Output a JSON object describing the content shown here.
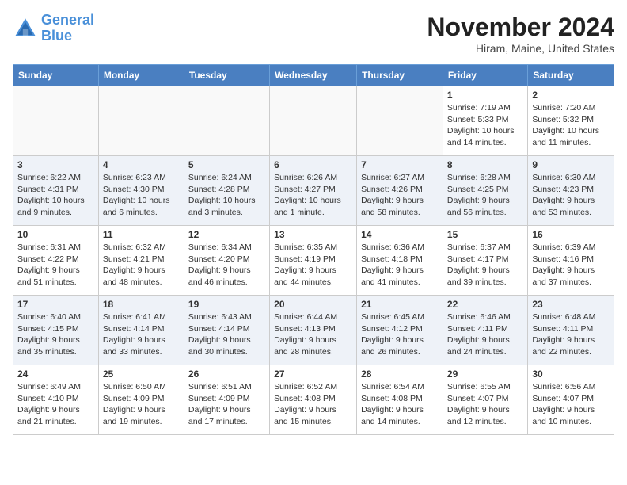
{
  "logo": {
    "line1": "General",
    "line2": "Blue"
  },
  "title": "November 2024",
  "location": "Hiram, Maine, United States",
  "days_of_week": [
    "Sunday",
    "Monday",
    "Tuesday",
    "Wednesday",
    "Thursday",
    "Friday",
    "Saturday"
  ],
  "weeks": [
    [
      {
        "day": "",
        "empty": true
      },
      {
        "day": "",
        "empty": true
      },
      {
        "day": "",
        "empty": true
      },
      {
        "day": "",
        "empty": true
      },
      {
        "day": "",
        "empty": true
      },
      {
        "day": "1",
        "sunrise": "Sunrise: 7:19 AM",
        "sunset": "Sunset: 5:33 PM",
        "daylight": "Daylight: 10 hours and 14 minutes."
      },
      {
        "day": "2",
        "sunrise": "Sunrise: 7:20 AM",
        "sunset": "Sunset: 5:32 PM",
        "daylight": "Daylight: 10 hours and 11 minutes."
      }
    ],
    [
      {
        "day": "3",
        "sunrise": "Sunrise: 6:22 AM",
        "sunset": "Sunset: 4:31 PM",
        "daylight": "Daylight: 10 hours and 9 minutes."
      },
      {
        "day": "4",
        "sunrise": "Sunrise: 6:23 AM",
        "sunset": "Sunset: 4:30 PM",
        "daylight": "Daylight: 10 hours and 6 minutes."
      },
      {
        "day": "5",
        "sunrise": "Sunrise: 6:24 AM",
        "sunset": "Sunset: 4:28 PM",
        "daylight": "Daylight: 10 hours and 3 minutes."
      },
      {
        "day": "6",
        "sunrise": "Sunrise: 6:26 AM",
        "sunset": "Sunset: 4:27 PM",
        "daylight": "Daylight: 10 hours and 1 minute."
      },
      {
        "day": "7",
        "sunrise": "Sunrise: 6:27 AM",
        "sunset": "Sunset: 4:26 PM",
        "daylight": "Daylight: 9 hours and 58 minutes."
      },
      {
        "day": "8",
        "sunrise": "Sunrise: 6:28 AM",
        "sunset": "Sunset: 4:25 PM",
        "daylight": "Daylight: 9 hours and 56 minutes."
      },
      {
        "day": "9",
        "sunrise": "Sunrise: 6:30 AM",
        "sunset": "Sunset: 4:23 PM",
        "daylight": "Daylight: 9 hours and 53 minutes."
      }
    ],
    [
      {
        "day": "10",
        "sunrise": "Sunrise: 6:31 AM",
        "sunset": "Sunset: 4:22 PM",
        "daylight": "Daylight: 9 hours and 51 minutes."
      },
      {
        "day": "11",
        "sunrise": "Sunrise: 6:32 AM",
        "sunset": "Sunset: 4:21 PM",
        "daylight": "Daylight: 9 hours and 48 minutes."
      },
      {
        "day": "12",
        "sunrise": "Sunrise: 6:34 AM",
        "sunset": "Sunset: 4:20 PM",
        "daylight": "Daylight: 9 hours and 46 minutes."
      },
      {
        "day": "13",
        "sunrise": "Sunrise: 6:35 AM",
        "sunset": "Sunset: 4:19 PM",
        "daylight": "Daylight: 9 hours and 44 minutes."
      },
      {
        "day": "14",
        "sunrise": "Sunrise: 6:36 AM",
        "sunset": "Sunset: 4:18 PM",
        "daylight": "Daylight: 9 hours and 41 minutes."
      },
      {
        "day": "15",
        "sunrise": "Sunrise: 6:37 AM",
        "sunset": "Sunset: 4:17 PM",
        "daylight": "Daylight: 9 hours and 39 minutes."
      },
      {
        "day": "16",
        "sunrise": "Sunrise: 6:39 AM",
        "sunset": "Sunset: 4:16 PM",
        "daylight": "Daylight: 9 hours and 37 minutes."
      }
    ],
    [
      {
        "day": "17",
        "sunrise": "Sunrise: 6:40 AM",
        "sunset": "Sunset: 4:15 PM",
        "daylight": "Daylight: 9 hours and 35 minutes."
      },
      {
        "day": "18",
        "sunrise": "Sunrise: 6:41 AM",
        "sunset": "Sunset: 4:14 PM",
        "daylight": "Daylight: 9 hours and 33 minutes."
      },
      {
        "day": "19",
        "sunrise": "Sunrise: 6:43 AM",
        "sunset": "Sunset: 4:14 PM",
        "daylight": "Daylight: 9 hours and 30 minutes."
      },
      {
        "day": "20",
        "sunrise": "Sunrise: 6:44 AM",
        "sunset": "Sunset: 4:13 PM",
        "daylight": "Daylight: 9 hours and 28 minutes."
      },
      {
        "day": "21",
        "sunrise": "Sunrise: 6:45 AM",
        "sunset": "Sunset: 4:12 PM",
        "daylight": "Daylight: 9 hours and 26 minutes."
      },
      {
        "day": "22",
        "sunrise": "Sunrise: 6:46 AM",
        "sunset": "Sunset: 4:11 PM",
        "daylight": "Daylight: 9 hours and 24 minutes."
      },
      {
        "day": "23",
        "sunrise": "Sunrise: 6:48 AM",
        "sunset": "Sunset: 4:11 PM",
        "daylight": "Daylight: 9 hours and 22 minutes."
      }
    ],
    [
      {
        "day": "24",
        "sunrise": "Sunrise: 6:49 AM",
        "sunset": "Sunset: 4:10 PM",
        "daylight": "Daylight: 9 hours and 21 minutes."
      },
      {
        "day": "25",
        "sunrise": "Sunrise: 6:50 AM",
        "sunset": "Sunset: 4:09 PM",
        "daylight": "Daylight: 9 hours and 19 minutes."
      },
      {
        "day": "26",
        "sunrise": "Sunrise: 6:51 AM",
        "sunset": "Sunset: 4:09 PM",
        "daylight": "Daylight: 9 hours and 17 minutes."
      },
      {
        "day": "27",
        "sunrise": "Sunrise: 6:52 AM",
        "sunset": "Sunset: 4:08 PM",
        "daylight": "Daylight: 9 hours and 15 minutes."
      },
      {
        "day": "28",
        "sunrise": "Sunrise: 6:54 AM",
        "sunset": "Sunset: 4:08 PM",
        "daylight": "Daylight: 9 hours and 14 minutes."
      },
      {
        "day": "29",
        "sunrise": "Sunrise: 6:55 AM",
        "sunset": "Sunset: 4:07 PM",
        "daylight": "Daylight: 9 hours and 12 minutes."
      },
      {
        "day": "30",
        "sunrise": "Sunrise: 6:56 AM",
        "sunset": "Sunset: 4:07 PM",
        "daylight": "Daylight: 9 hours and 10 minutes."
      }
    ]
  ]
}
